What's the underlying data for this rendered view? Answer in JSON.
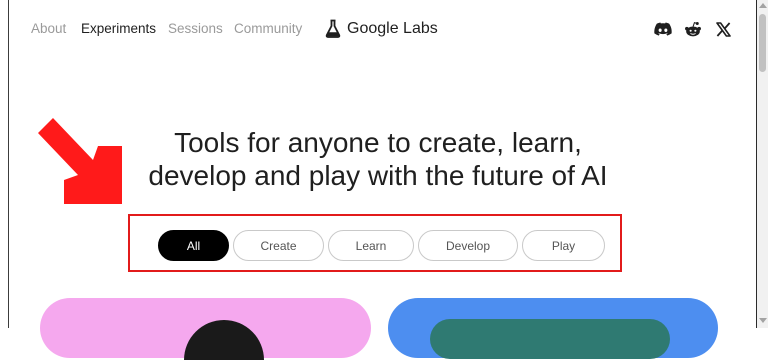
{
  "nav": {
    "items": [
      {
        "label": "About",
        "active": false
      },
      {
        "label": "Experiments",
        "active": true
      },
      {
        "label": "Sessions",
        "active": false
      },
      {
        "label": "Community",
        "active": false
      }
    ]
  },
  "brand": {
    "name": "Google Labs",
    "icon": "flask-icon"
  },
  "social": [
    "discord-icon",
    "reddit-icon",
    "x-icon"
  ],
  "hero": {
    "line1": "Tools for anyone to create, learn,",
    "line2": "develop and play with the future of AI"
  },
  "filters": {
    "selected": "All",
    "options": [
      "All",
      "Create",
      "Learn",
      "Develop",
      "Play"
    ]
  },
  "colors": {
    "annotation_red": "#e21b1b",
    "card_pink": "#f5a8ee",
    "card_blue": "#4d8ef0"
  }
}
